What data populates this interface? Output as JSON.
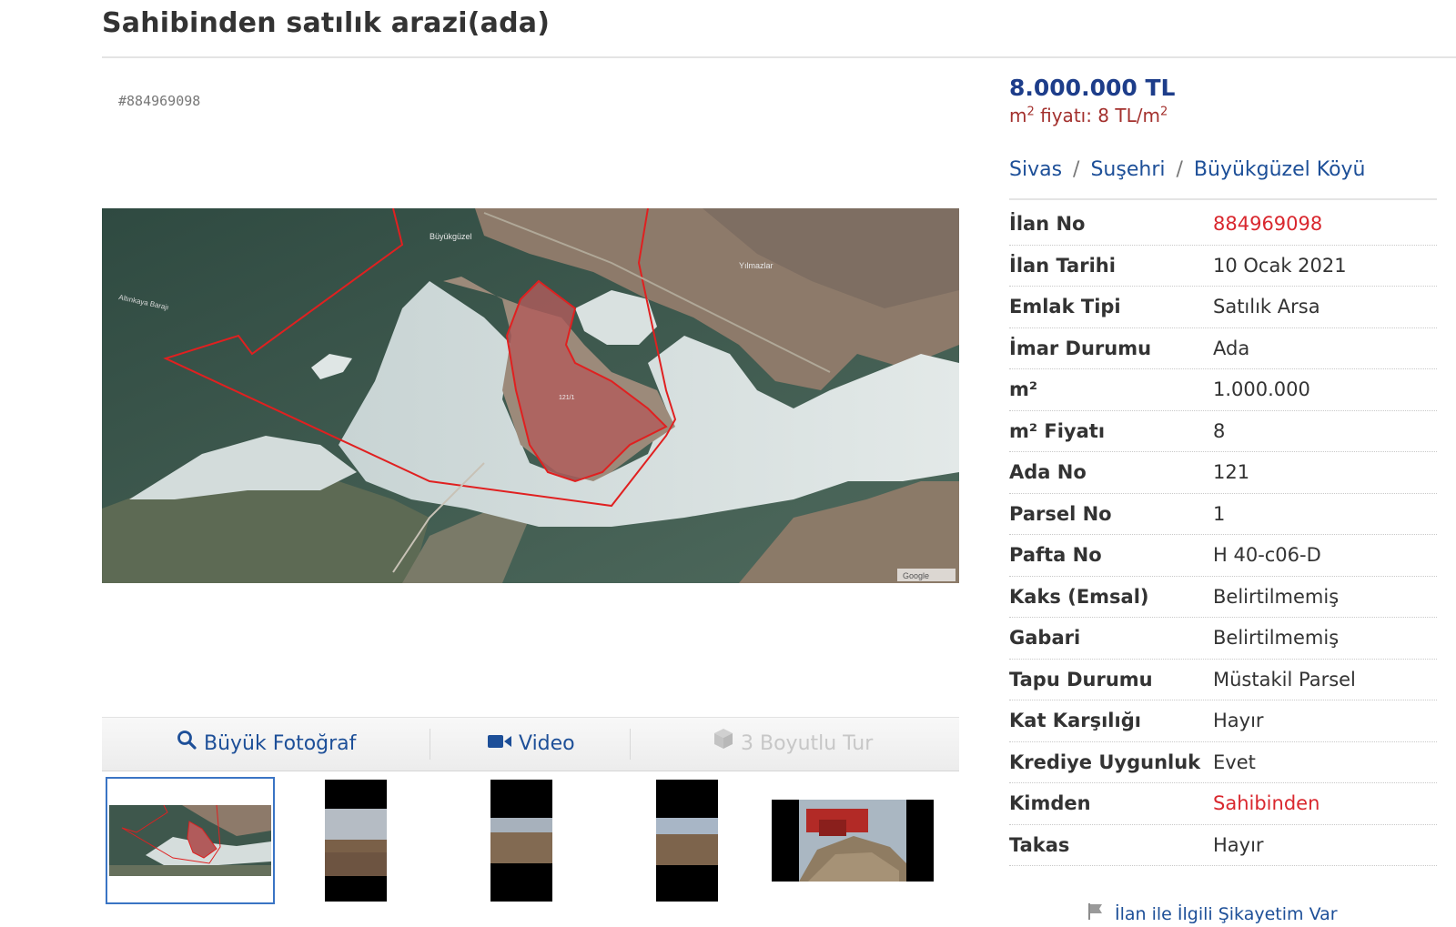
{
  "page": {
    "title": "Sahibinden satılık arazi(ada)",
    "listing_id": "#884969098"
  },
  "summary": {
    "price": "8.000.000 TL",
    "m2_price_prefix": "m",
    "m2_price_middle": " fiyatı: 8 TL/m",
    "sup": "2"
  },
  "breadcrumb": [
    "Sivas",
    "Suşehri",
    "Büyükgüzel Köyü"
  ],
  "breadcrumb_sep": "/",
  "details": [
    {
      "label": "İlan No",
      "value": "884969098",
      "highlight": true
    },
    {
      "label": "İlan Tarihi",
      "value": "10 Ocak 2021",
      "highlight": false
    },
    {
      "label": "Emlak Tipi",
      "value": "Satılık Arsa",
      "highlight": false
    },
    {
      "label": "İmar Durumu",
      "value": "Ada",
      "highlight": false
    },
    {
      "label": "m²",
      "value": "1.000.000",
      "highlight": false
    },
    {
      "label": "m² Fiyatı",
      "value": "8",
      "highlight": false
    },
    {
      "label": "Ada No",
      "value": "121",
      "highlight": false
    },
    {
      "label": "Parsel No",
      "value": "1",
      "highlight": false
    },
    {
      "label": "Pafta No",
      "value": "H 40-c06-D",
      "highlight": false
    },
    {
      "label": "Kaks (Emsal)",
      "value": "Belirtilmemiş",
      "highlight": false
    },
    {
      "label": "Gabari",
      "value": "Belirtilmemiş",
      "highlight": false
    },
    {
      "label": "Tapu Durumu",
      "value": "Müstakil Parsel",
      "highlight": false
    },
    {
      "label": "Kat Karşılığı",
      "value": "Hayır",
      "highlight": false
    },
    {
      "label": "Krediye Uygunluk",
      "value": "Evet",
      "highlight": false
    },
    {
      "label": "Kimden",
      "value": "Sahibinden",
      "highlight": true
    },
    {
      "label": "Takas",
      "value": "Hayır",
      "highlight": false
    }
  ],
  "media_tabs": {
    "big_photo": "Büyük Fotoğraf",
    "video": "Video",
    "tour": "3 Boyutlu Tur"
  },
  "map_labels": {
    "village1": "Büyükgüzel",
    "village2": "Yılmazlar",
    "dam": "Altınkaya Barajı",
    "parcel": "121/1",
    "attribution": "Google"
  },
  "complaint": "İlan ile İlgili Şikayetim Var",
  "colors": {
    "price_blue": "#1d3d8a",
    "link_blue": "#1d4f98",
    "red_value": "#d9272e",
    "m2_red": "#a3302d"
  },
  "icons": {
    "big_photo": "search-icon",
    "video": "video-camera-icon",
    "tour": "cube-icon",
    "complaint": "flag-icon"
  }
}
